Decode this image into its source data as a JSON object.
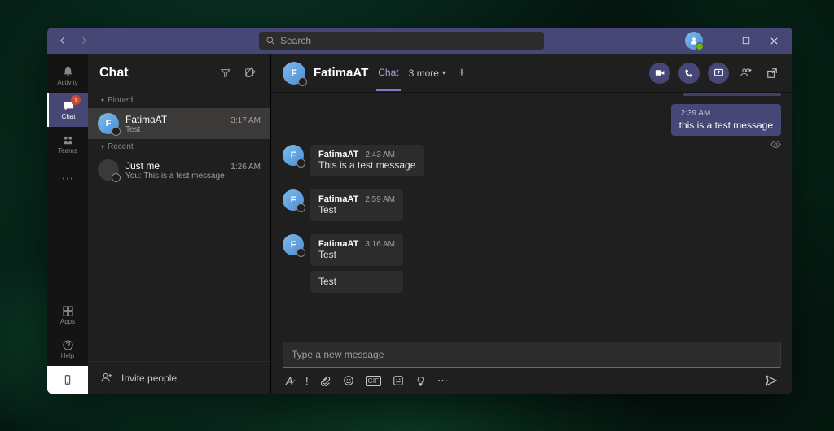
{
  "search": {
    "placeholder": "Search"
  },
  "rail": {
    "activity": "Activity",
    "chat": "Chat",
    "chat_badge": "1",
    "teams": "Teams",
    "apps": "Apps",
    "help": "Help"
  },
  "list": {
    "title": "Chat",
    "pinned_label": "Pinned",
    "recent_label": "Recent",
    "pinned": [
      {
        "name": "FatimaAT",
        "preview": "Test",
        "time": "3:17 AM",
        "initial": "F"
      }
    ],
    "recent": [
      {
        "name": "Just me",
        "preview": "You: This is a test message",
        "time": "1:26 AM",
        "initial": ""
      }
    ],
    "invite": "Invite people"
  },
  "convo": {
    "title": "FatimaAT",
    "initial": "F",
    "tab_chat": "Chat",
    "more_tabs": "3 more",
    "outgoing": {
      "time": "2:39 AM",
      "text": "this is a test message"
    },
    "incoming": [
      {
        "name": "FatimaAT",
        "time": "2:43 AM",
        "bubbles": [
          "This is a test message"
        ]
      },
      {
        "name": "FatimaAT",
        "time": "2:59 AM",
        "bubbles": [
          "Test"
        ]
      },
      {
        "name": "FatimaAT",
        "time": "3:16 AM",
        "bubbles": [
          "Test",
          "Test"
        ]
      }
    ],
    "compose_placeholder": "Type a new message"
  }
}
